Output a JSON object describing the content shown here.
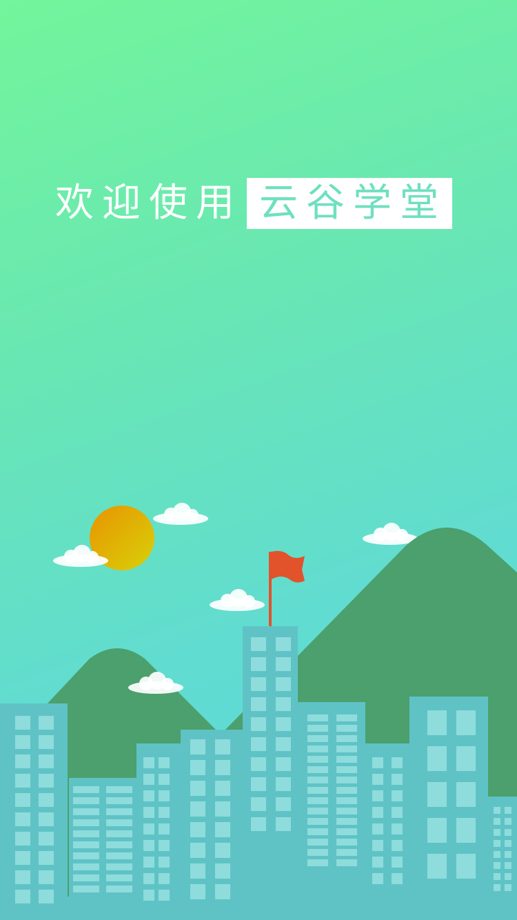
{
  "splash": {
    "welcome_prefix": "欢迎使用",
    "app_name": "云谷学堂"
  },
  "colors": {
    "sky_top": "#72f59b",
    "sky_bottom": "#5bd6e0",
    "mountain": "#4ba06e",
    "building": "#5fc3c6",
    "window": "#8fdcdc",
    "flag": "#e2522b",
    "sun_top": "#e89400",
    "sun_bottom": "#d8d10a",
    "brand_text": "#6ee0bf"
  }
}
